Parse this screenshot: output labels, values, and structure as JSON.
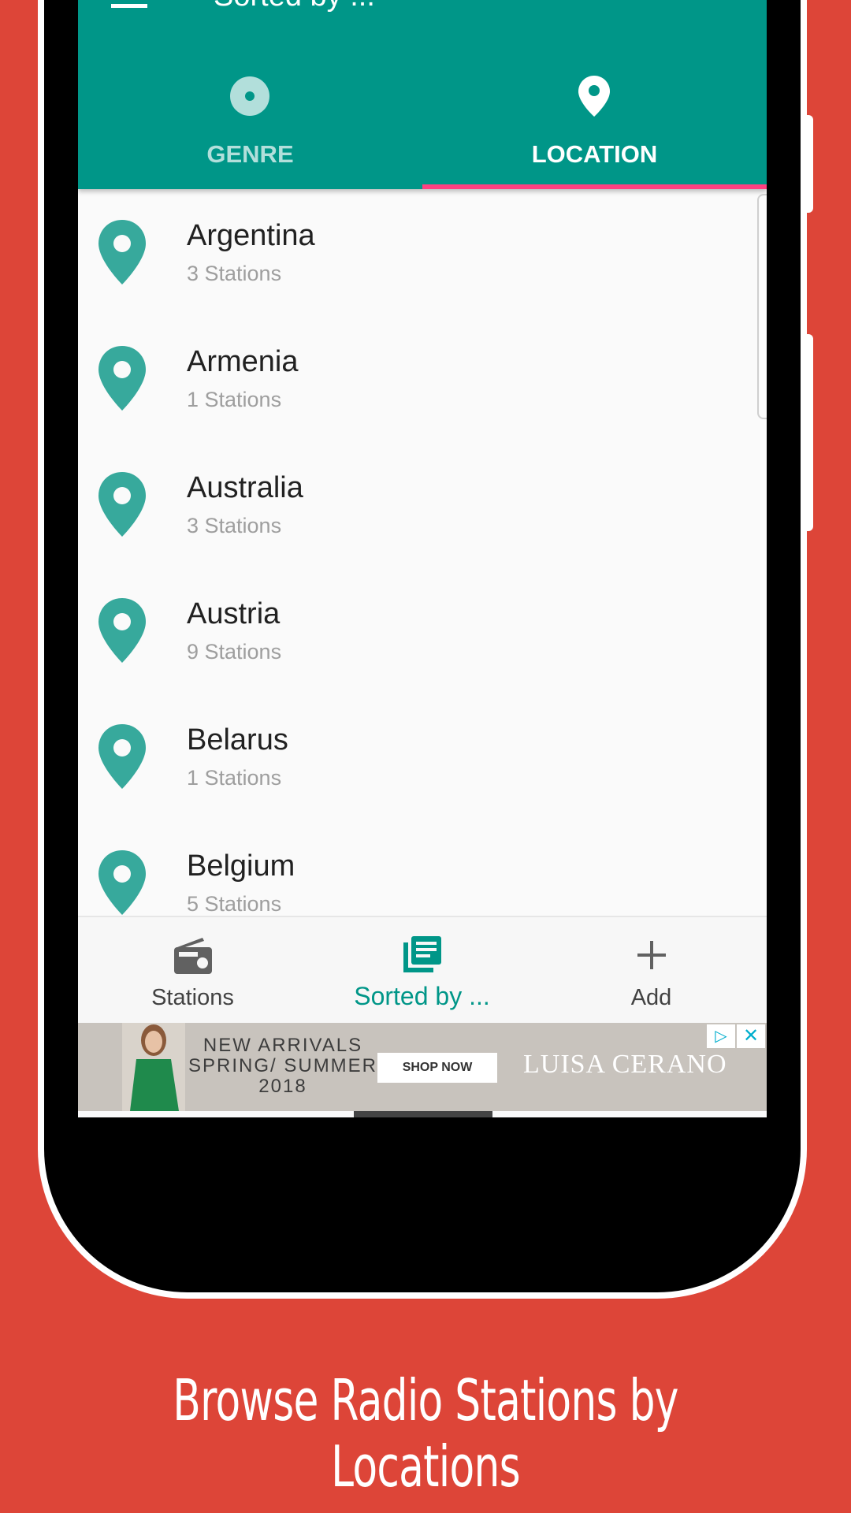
{
  "app": {
    "title": "Sorted by ...",
    "accent": "#009688",
    "tab_indicator_color": "#ff4081"
  },
  "tabs": [
    {
      "label": "GENRE",
      "icon": "disc-icon",
      "selected": false
    },
    {
      "label": "LOCATION",
      "icon": "location-pin-icon",
      "selected": true
    }
  ],
  "locations": [
    {
      "name": "Argentina",
      "count": "3 Stations"
    },
    {
      "name": "Armenia",
      "count": "1 Stations"
    },
    {
      "name": "Australia",
      "count": "3 Stations"
    },
    {
      "name": "Austria",
      "count": "9 Stations"
    },
    {
      "name": "Belarus",
      "count": "1 Stations"
    },
    {
      "name": "Belgium",
      "count": "5 Stations"
    }
  ],
  "bottom_nav": [
    {
      "label": "Stations",
      "icon": "radio-icon",
      "active": false
    },
    {
      "label": "Sorted by ...",
      "icon": "library-icon",
      "active": true
    },
    {
      "label": "Add",
      "icon": "plus-icon",
      "active": false
    }
  ],
  "ad": {
    "headline": "NEW ARRIVALS SPRING/ SUMMER 2018",
    "cta": "SHOP NOW",
    "brand": "LUISA CERANO",
    "info_icon": "ad-choices-icon",
    "close_symbol": "✕"
  },
  "caption": "Browse Radio Stations by Locations"
}
